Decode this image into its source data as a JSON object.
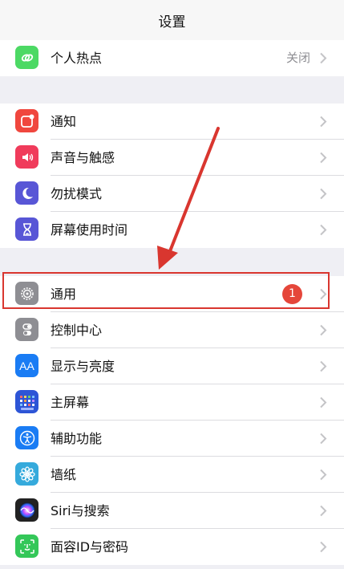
{
  "header": {
    "title": "设置"
  },
  "groups": [
    {
      "items": [
        {
          "label": "个人热点",
          "detail": "关闭",
          "icon": "hotspot-icon",
          "color": "#4cd964"
        }
      ]
    },
    {
      "items": [
        {
          "label": "通知",
          "icon": "notification-icon",
          "color": "#f0473e"
        },
        {
          "label": "声音与触感",
          "icon": "speaker-icon",
          "color": "#f03b5b"
        },
        {
          "label": "勿扰模式",
          "icon": "moon-icon",
          "color": "#5856d6"
        },
        {
          "label": "屏幕使用时间",
          "icon": "hourglass-icon",
          "color": "#5856d6"
        }
      ]
    },
    {
      "items": [
        {
          "label": "通用",
          "badge": "1",
          "icon": "gear-icon",
          "color": "#8e8e93"
        },
        {
          "label": "控制中心",
          "icon": "toggles-icon",
          "color": "#8e8e93"
        },
        {
          "label": "显示与亮度",
          "icon": "aa-icon",
          "icon_text": "AA",
          "color": "#1a7cf4"
        },
        {
          "label": "主屏幕",
          "icon": "home-screen-icon",
          "color": "#2d55d6"
        },
        {
          "label": "辅助功能",
          "icon": "accessibility-icon",
          "color": "#1a7cf4"
        },
        {
          "label": "墙纸",
          "icon": "flower-icon",
          "color": "#35aadc"
        },
        {
          "label": "Siri与搜索",
          "icon": "siri-icon",
          "color": "#222222"
        },
        {
          "label": "面容ID与密码",
          "icon": "face-id-icon",
          "color": "#34c759"
        }
      ]
    }
  ],
  "annotation": {
    "highlight_color": "#d9362f"
  }
}
